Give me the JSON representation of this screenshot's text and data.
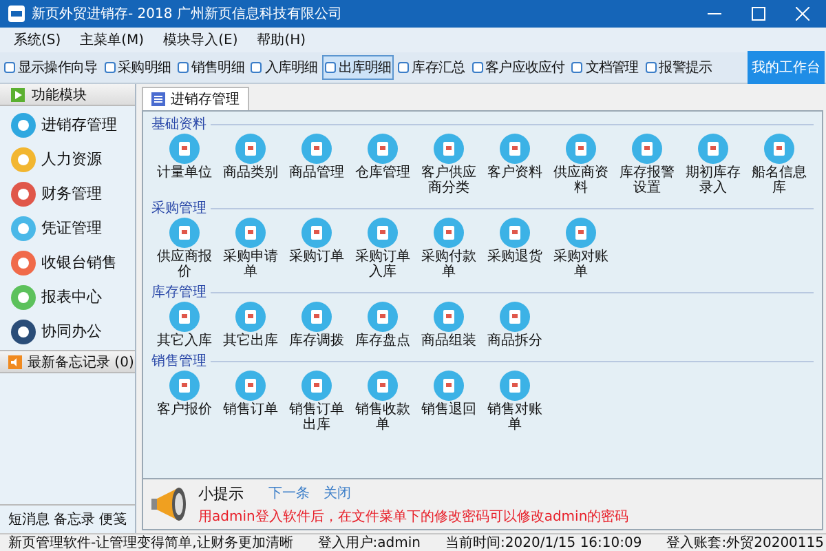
{
  "window": {
    "title": "新页外贸进销存- 2018 广州新页信息科技有限公司"
  },
  "menu": [
    "系统(S)",
    "主菜单(M)",
    "模块导入(E)",
    "帮助(H)"
  ],
  "toolbar": {
    "items": [
      {
        "label": "显示操作向导",
        "checked": false,
        "selected": false
      },
      {
        "label": "采购明细",
        "checked": false,
        "selected": false
      },
      {
        "label": "销售明细",
        "checked": false,
        "selected": false
      },
      {
        "label": "入库明细",
        "checked": false,
        "selected": false
      },
      {
        "label": "出库明细",
        "checked": false,
        "selected": true
      },
      {
        "label": "库存汇总",
        "checked": false,
        "selected": false
      },
      {
        "label": "客户应收应付",
        "checked": false,
        "selected": false
      },
      {
        "label": "文档管理",
        "checked": false,
        "selected": false
      },
      {
        "label": "报警提示",
        "checked": false,
        "selected": false
      }
    ],
    "button": "我的工作台"
  },
  "sidebar": {
    "title": "功能模块",
    "items": [
      {
        "label": "进销存管理",
        "color": "#2fa8e0"
      },
      {
        "label": "人力资源",
        "color": "#f2b630"
      },
      {
        "label": "财务管理",
        "color": "#e0574a"
      },
      {
        "label": "凭证管理",
        "color": "#4ab8e8"
      },
      {
        "label": "收银台销售",
        "color": "#f06a4a"
      },
      {
        "label": "报表中心",
        "color": "#5cc15c"
      },
      {
        "label": "协同办公",
        "color": "#2a4d78"
      }
    ],
    "memo": "最新备忘记录 (0)",
    "bottom_tabs": [
      "短消息",
      "备忘录",
      "便笺"
    ]
  },
  "tab": "进销存管理",
  "sections": [
    {
      "title": "基础资料",
      "items": [
        "计量单位",
        "商品类别",
        "商品管理",
        "仓库管理",
        "客户供应商分类",
        "客户资料",
        "供应商资料",
        "库存报警设置",
        "期初库存录入",
        "船名信息库"
      ]
    },
    {
      "title": "采购管理",
      "items": [
        "供应商报价",
        "采购申请单",
        "采购订单",
        "采购订单入库",
        "采购付款单",
        "采购退货",
        "采购对账单"
      ]
    },
    {
      "title": "库存管理",
      "items": [
        "其它入库",
        "其它出库",
        "库存调拨",
        "库存盘点",
        "商品组装",
        "商品拆分"
      ]
    },
    {
      "title": "销售管理",
      "items": [
        "客户报价",
        "销售订单",
        "销售订单出库",
        "销售收款单",
        "销售退回",
        "销售对账单"
      ]
    }
  ],
  "tip": {
    "title": "小提示",
    "next": "下一条",
    "close": "关闭",
    "text": "用admin登入软件后，在文件菜单下的修改密码可以修改admin的密码"
  },
  "status_bar": [
    "新页管理软件-让管理变得简单,让财务更加清晰",
    "登入用户:admin",
    "当前时间:2020/1/15 16:10:09",
    "登入账套:外贸20200115"
  ]
}
